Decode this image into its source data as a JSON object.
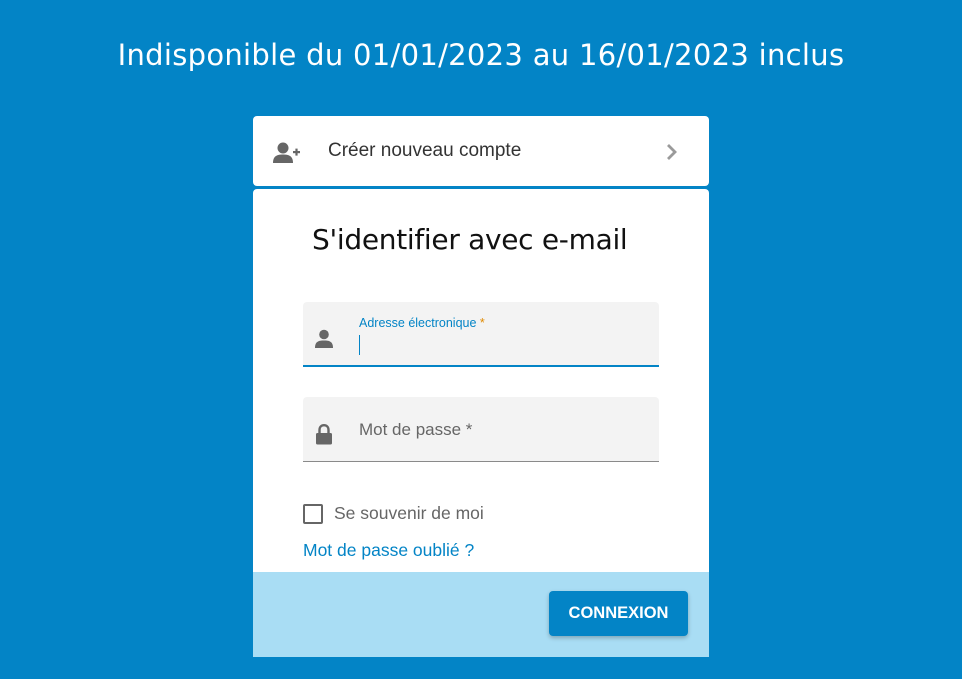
{
  "banner": {
    "text": "Indisponible du 01/01/2023 au 16/01/2023 inclus"
  },
  "create_account": {
    "label": "Créer nouveau compte",
    "icon": "add-user-icon",
    "chevron_icon": "chevron-right-icon"
  },
  "login": {
    "title": "S'identifier avec e-mail",
    "email": {
      "label": "Adresse électronique",
      "required_mark": "*",
      "value": "",
      "icon": "user-icon"
    },
    "password": {
      "label": "Mot de passe *",
      "value": "",
      "icon": "lock-icon"
    },
    "remember_label": "Se souvenir de moi",
    "remember_checked": false,
    "forgot_label": "Mot de passe oublié ?",
    "submit_label": "CONNEXION"
  },
  "colors": {
    "background": "#0384c6",
    "accent": "#0384c6",
    "footer": "#a9ddf4",
    "required": "#e08a00"
  }
}
